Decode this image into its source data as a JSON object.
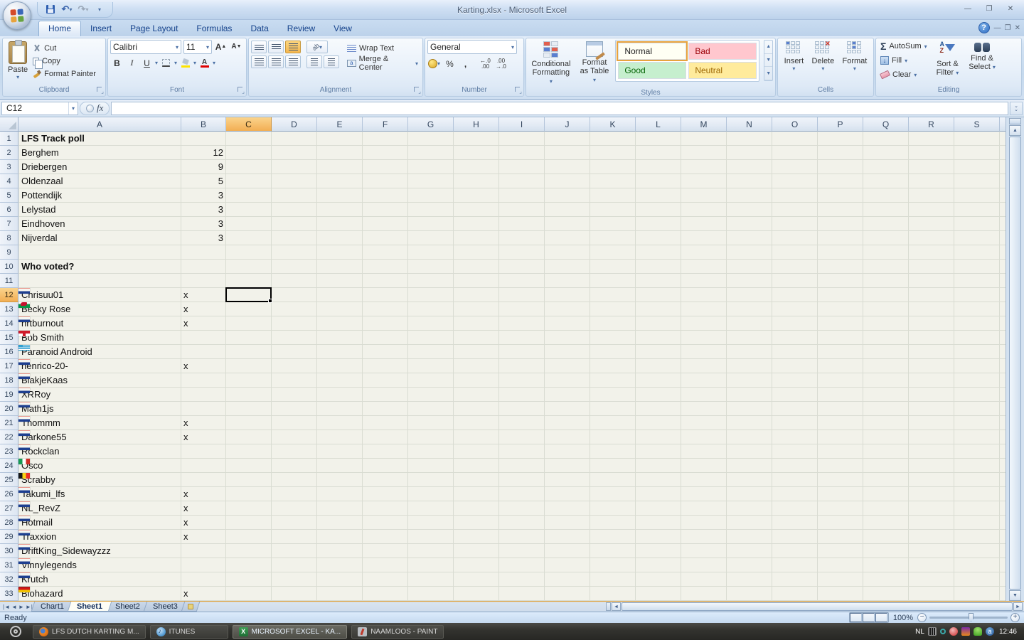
{
  "window": {
    "title": "Karting.xlsx - Microsoft Excel"
  },
  "ribbon_tabs": [
    {
      "label": "Home",
      "active": true
    },
    {
      "label": "Insert",
      "active": false
    },
    {
      "label": "Page Layout",
      "active": false
    },
    {
      "label": "Formulas",
      "active": false
    },
    {
      "label": "Data",
      "active": false
    },
    {
      "label": "Review",
      "active": false
    },
    {
      "label": "View",
      "active": false
    }
  ],
  "ribbon": {
    "clipboard": {
      "label": "Clipboard",
      "paste": "Paste",
      "cut": "Cut",
      "copy": "Copy",
      "format_painter": "Format Painter"
    },
    "font": {
      "label": "Font",
      "family": "Calibri",
      "size": "11",
      "bold": "B",
      "italic": "I",
      "underline": "U"
    },
    "alignment": {
      "label": "Alignment",
      "wrap": "Wrap Text",
      "merge": "Merge & Center"
    },
    "number": {
      "label": "Number",
      "format": "General",
      "percent": "%",
      "comma": ",",
      "inc_dec": ".00",
      "dec_dec": ".0"
    },
    "styles": {
      "label": "Styles",
      "conditional_line1": "Conditional",
      "conditional_line2": "Formatting",
      "format_table_line1": "Format",
      "format_table_line2": "as Table",
      "gallery": [
        {
          "label": "Normal",
          "bg": "#fffff4",
          "color": "#1f1f1f",
          "selected": true
        },
        {
          "label": "Bad",
          "bg": "#ffc7ce",
          "color": "#9c0006",
          "selected": false
        },
        {
          "label": "Good",
          "bg": "#c6efce",
          "color": "#006100",
          "selected": false
        },
        {
          "label": "Neutral",
          "bg": "#ffeb9c",
          "color": "#9c6500",
          "selected": false
        }
      ]
    },
    "cells": {
      "label": "Cells",
      "insert": "Insert",
      "delete": "Delete",
      "format": "Format"
    },
    "editing": {
      "label": "Editing",
      "sigma": "Σ",
      "autosum": "AutoSum",
      "fill": "Fill",
      "clear": "Clear",
      "sort_line1": "Sort &",
      "sort_line2": "Filter",
      "find_line1": "Find &",
      "find_line2": "Select"
    }
  },
  "formula_bar": {
    "name_box": "C12",
    "fx": "fx"
  },
  "grid": {
    "columns": [
      "A",
      "B",
      "C",
      "D",
      "E",
      "F",
      "G",
      "H",
      "I",
      "J",
      "K",
      "L",
      "M",
      "N",
      "O",
      "P",
      "Q",
      "R",
      "S"
    ],
    "selection": {
      "col": "C",
      "row": 12,
      "ref": "C12"
    },
    "rows": [
      {
        "n": 1,
        "a": "LFS Track poll",
        "b": "",
        "bold": true,
        "flag": ""
      },
      {
        "n": 2,
        "a": "Berghem",
        "b": "12",
        "bold": false,
        "flag": ""
      },
      {
        "n": 3,
        "a": "Driebergen",
        "b": "9",
        "bold": false,
        "flag": ""
      },
      {
        "n": 4,
        "a": "Oldenzaal",
        "b": "5",
        "bold": false,
        "flag": ""
      },
      {
        "n": 5,
        "a": "Pottendijk",
        "b": "3",
        "bold": false,
        "flag": ""
      },
      {
        "n": 6,
        "a": "Lelystad",
        "b": "3",
        "bold": false,
        "flag": ""
      },
      {
        "n": 7,
        "a": "Eindhoven",
        "b": "3",
        "bold": false,
        "flag": ""
      },
      {
        "n": 8,
        "a": "Nijverdal",
        "b": "3",
        "bold": false,
        "flag": ""
      },
      {
        "n": 9,
        "a": "",
        "b": "",
        "bold": false,
        "flag": ""
      },
      {
        "n": 10,
        "a": "Who voted?",
        "b": "",
        "bold": true,
        "flag": ""
      },
      {
        "n": 11,
        "a": "",
        "b": "",
        "bold": false,
        "flag": ""
      },
      {
        "n": 12,
        "a": "Chrisuu01",
        "b": "x",
        "bold": false,
        "flag": "nl"
      },
      {
        "n": 13,
        "a": "Becky Rose",
        "b": "x",
        "bold": false,
        "flag": "wales"
      },
      {
        "n": 14,
        "a": "hrtburnout",
        "b": "x",
        "bold": false,
        "flag": "nl"
      },
      {
        "n": 15,
        "a": "Bob Smith",
        "b": "",
        "bold": false,
        "flag": "england"
      },
      {
        "n": 16,
        "a": "Paranoid Android",
        "b": "",
        "bold": false,
        "flag": "greece"
      },
      {
        "n": 17,
        "a": "henrico-20-",
        "b": "x",
        "bold": false,
        "flag": "nl"
      },
      {
        "n": 18,
        "a": "BlakjeKaas",
        "b": "",
        "bold": false,
        "flag": "nl"
      },
      {
        "n": 19,
        "a": "XRRoy",
        "b": "",
        "bold": false,
        "flag": "nl"
      },
      {
        "n": 20,
        "a": "Math1js",
        "b": "",
        "bold": false,
        "flag": "nl"
      },
      {
        "n": 21,
        "a": "Thommm",
        "b": "x",
        "bold": false,
        "flag": "nl"
      },
      {
        "n": 22,
        "a": "Darkone55",
        "b": "x",
        "bold": false,
        "flag": "nl"
      },
      {
        "n": 23,
        "a": "Rockclan",
        "b": "",
        "bold": false,
        "flag": "nl"
      },
      {
        "n": 24,
        "a": "Osco",
        "b": "",
        "bold": false,
        "flag": "italy"
      },
      {
        "n": 25,
        "a": "Scrabby",
        "b": "",
        "bold": false,
        "flag": "belgium"
      },
      {
        "n": 26,
        "a": "Takumi_lfs",
        "b": "x",
        "bold": false,
        "flag": "nl"
      },
      {
        "n": 27,
        "a": "NL_RevZ",
        "b": "x",
        "bold": false,
        "flag": "nl"
      },
      {
        "n": 28,
        "a": "Hotmail",
        "b": "x",
        "bold": false,
        "flag": "nl"
      },
      {
        "n": 29,
        "a": "Traxxion",
        "b": "x",
        "bold": false,
        "flag": "nl"
      },
      {
        "n": 30,
        "a": "DriftKing_Sidewayzzz",
        "b": "",
        "bold": false,
        "flag": "nl"
      },
      {
        "n": 31,
        "a": "Vinnylegends",
        "b": "",
        "bold": false,
        "flag": "nl"
      },
      {
        "n": 32,
        "a": "Krutch",
        "b": "",
        "bold": false,
        "flag": "nl"
      },
      {
        "n": 33,
        "a": "Biohazard",
        "b": "x",
        "bold": false,
        "flag": "germany"
      }
    ]
  },
  "sheet_bar": {
    "tabs": [
      {
        "label": "Chart1",
        "active": false
      },
      {
        "label": "Sheet1",
        "active": true
      },
      {
        "label": "Sheet2",
        "active": false
      },
      {
        "label": "Sheet3",
        "active": false
      }
    ]
  },
  "status_bar": {
    "mode": "Ready",
    "zoom": "100%"
  },
  "taskbar": {
    "buttons": [
      {
        "label": "LFS DUTCH KARTING M...",
        "icon": "firefox-icon",
        "active": false
      },
      {
        "label": "ITUNES",
        "icon": "itunes-icon",
        "active": false
      },
      {
        "label": "MICROSOFT EXCEL - KA...",
        "icon": "excel-icon",
        "active": true
      },
      {
        "label": "NAAMLOOS - PAINT",
        "icon": "paint-icon",
        "active": false
      }
    ],
    "tray": {
      "language": "NL",
      "time": "12:46",
      "icons": [
        "keyboard-icon",
        "ring-icon",
        "media-player-icon",
        "winamp-icon",
        "messenger-icon",
        "avast-icon"
      ]
    }
  }
}
